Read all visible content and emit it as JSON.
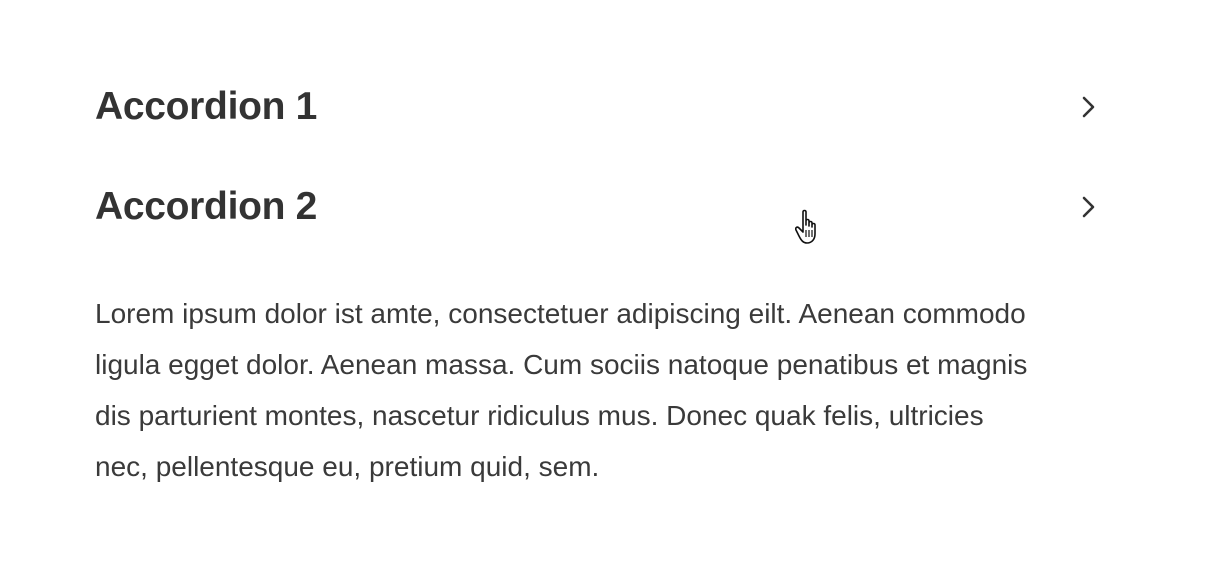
{
  "accordions": [
    {
      "title": "Accordion 1",
      "icon": "chevron-right-icon",
      "expanded": false
    },
    {
      "title": "Accordion 2",
      "icon": "chevron-right-icon",
      "expanded": true,
      "content": "Lorem ipsum dolor ist amte, consectetuer adipiscing eilt. Aenean commodo ligula egget dolor. Aenean massa. Cum sociis natoque penatibus et magnis dis parturient montes, nascetur ridiculus mus. Donec quak felis, ultricies nec, pellentesque eu, pretium quid, sem."
    }
  ],
  "cursor": {
    "icon": "hand-pointer-icon"
  },
  "colors": {
    "text": "#333333",
    "background": "#ffffff"
  }
}
